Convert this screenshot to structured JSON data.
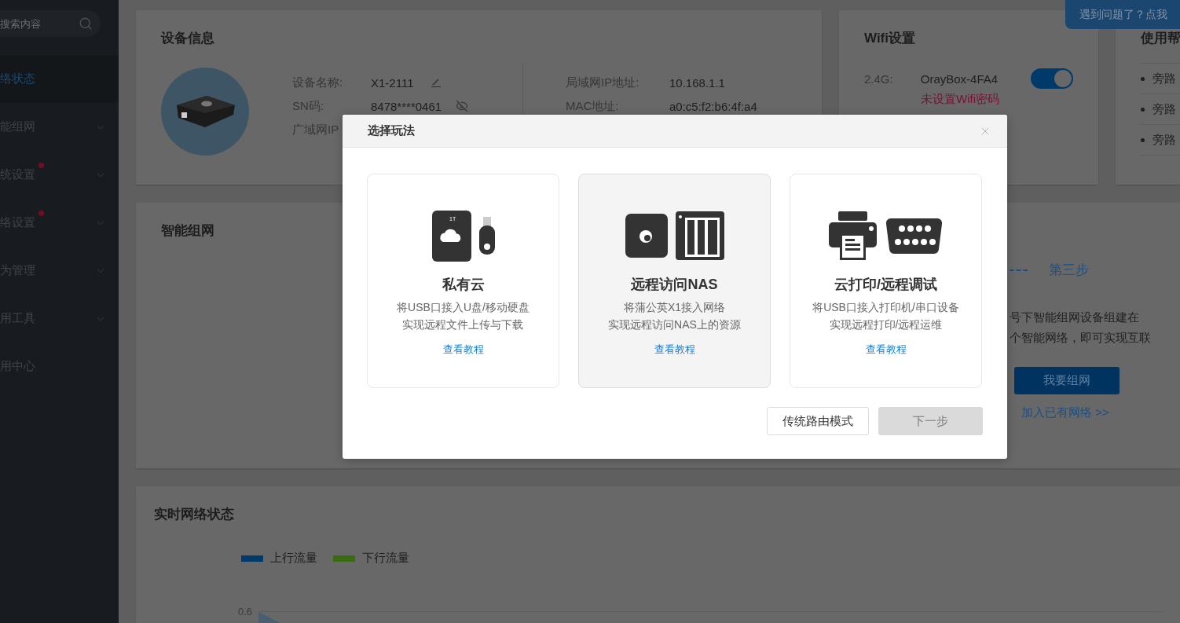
{
  "sidebar": {
    "search": {
      "placeholder": "搜索内容"
    },
    "items": [
      {
        "label": "络状态",
        "selected": true,
        "expandable": false,
        "alert": false
      },
      {
        "label": "能组网",
        "selected": false,
        "expandable": true,
        "alert": false
      },
      {
        "label": "统设置",
        "selected": false,
        "expandable": true,
        "alert": true
      },
      {
        "label": "络设置",
        "selected": false,
        "expandable": true,
        "alert": true
      },
      {
        "label": "为管理",
        "selected": false,
        "expandable": true,
        "alert": false
      },
      {
        "label": "用工具",
        "selected": false,
        "expandable": true,
        "alert": false
      },
      {
        "label": "用中心",
        "selected": false,
        "expandable": false,
        "alert": false
      }
    ]
  },
  "help_bubble": "遇到问题了？点我",
  "device_info": {
    "title": "设备信息",
    "fields": [
      {
        "label": "设备名称:",
        "value": "X1-2111",
        "kind": "edit"
      },
      {
        "label": "SN码:",
        "value": "8478****0461",
        "kind": "hidden"
      },
      {
        "label": "广域网IP",
        "kind": "none"
      }
    ],
    "lan": [
      {
        "label": "局域网IP地址:",
        "value": "10.168.1.1"
      },
      {
        "label": "MAC地址:",
        "value": "a0:c5:f2:b6:4f:a4"
      }
    ]
  },
  "wifi": {
    "title": "Wifi设置",
    "band": "2.4G:",
    "ssid": "OrayBox-4FA4",
    "on": true,
    "warning": "未设置Wifi密码"
  },
  "help": {
    "title": "使用帮",
    "items": [
      "旁路",
      "旁路",
      "旁路"
    ]
  },
  "smart_network": {
    "title": "智能组网",
    "step": "第三步",
    "text": [
      "号下智能组网设备组建在",
      "个智能网络，即可实现互联"
    ],
    "button": "我要组网",
    "link": "加入已有网络 >>"
  },
  "realtime": {
    "title": "实时网络状态",
    "legend": [
      {
        "label": "上行流量",
        "color": "#003a6b"
      },
      {
        "label": "下行流量",
        "color": "#3a6a12"
      }
    ],
    "y_tick": "0.6"
  },
  "modal": {
    "title": "选择玩法",
    "cards": [
      {
        "kind": "storage",
        "title": "私有云",
        "lines": [
          "将USB口接入U盘/移动硬盘",
          "实现远程文件上传与下载"
        ],
        "link": "查看教程",
        "selected": false,
        "drive_label": "1T"
      },
      {
        "kind": "nas",
        "title": "远程访问NAS",
        "lines": [
          "将蒲公英X1接入网络",
          "实现远程访问NAS上的资源"
        ],
        "link": "查看教程",
        "selected": true
      },
      {
        "kind": "print",
        "title": "云打印/远程调试",
        "lines": [
          "将USB口接入打印机/串口设备",
          "实现远程打印/远程运维"
        ],
        "link": "查看教程",
        "selected": false
      }
    ],
    "buttons": [
      {
        "label": "传统路由模式",
        "disabled": false
      },
      {
        "label": "下一步",
        "disabled": true
      }
    ]
  }
}
